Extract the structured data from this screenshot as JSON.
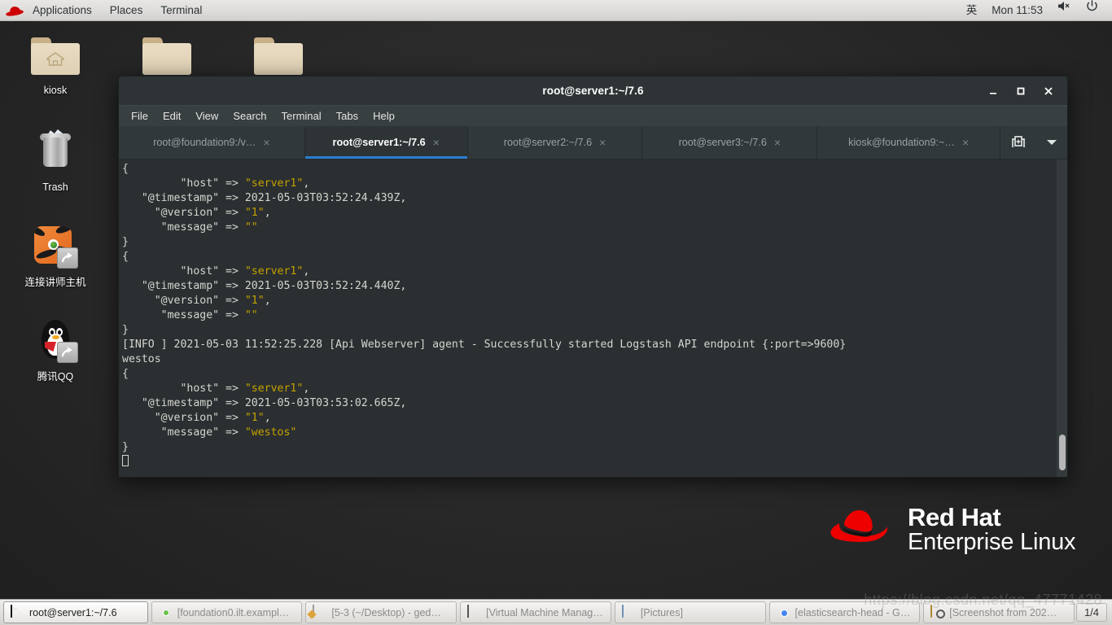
{
  "top_panel": {
    "logo_icon": "redhat-hat-icon",
    "menus": [
      "Applications",
      "Places",
      "Terminal"
    ],
    "input_method": "英",
    "clock": "Mon 11:53",
    "volume_icon": "volume-muted-icon",
    "power_icon": "power-icon"
  },
  "desktop": {
    "icons": [
      {
        "label": "kiosk",
        "icon": "home-folder-icon"
      },
      {
        "label": "Trash",
        "icon": "trash-icon"
      },
      {
        "label": "连接讲师主机",
        "icon": "tigervnc-shortcut-icon"
      },
      {
        "label": "腾讯QQ",
        "icon": "qq-shortcut-icon"
      }
    ],
    "folders": [
      {
        "icon": "folder-icon"
      },
      {
        "icon": "folder-icon"
      }
    ],
    "brand": {
      "line1": "Red Hat",
      "line2": "Enterprise Linux",
      "icon": "redhat-logo-icon"
    }
  },
  "terminal": {
    "title": "root@server1:~/7.6",
    "window_buttons": {
      "minimize": "−",
      "maximize": "□",
      "close": "✕"
    },
    "menus": [
      "File",
      "Edit",
      "View",
      "Search",
      "Terminal",
      "Tabs",
      "Help"
    ],
    "tabs": [
      {
        "label": "root@foundation9:/v…",
        "active": false
      },
      {
        "label": "root@server1:~/7.6",
        "active": true
      },
      {
        "label": "root@server2:~/7.6",
        "active": false
      },
      {
        "label": "root@server3:~/7.6",
        "active": false
      },
      {
        "label": "kiosk@foundation9:~…",
        "active": false
      }
    ],
    "new_tab_icon": "new-tab-icon",
    "tab_menu_icon": "chevron-down-icon",
    "close_tab_glyph": "×",
    "colors": {
      "background": "#2b2f31",
      "foreground": "#d3d7cf",
      "string": "#c4a000",
      "tab_active_underline": "#2a7fd4"
    },
    "output_lines": [
      {
        "text": "{"
      },
      {
        "text": "         \"host\" => ",
        "string": "\"server1\"",
        "tail": ","
      },
      {
        "text": "   \"@timestamp\" => 2021-05-03T03:52:24.439Z,"
      },
      {
        "text": "     \"@version\" => ",
        "string": "\"1\"",
        "tail": ","
      },
      {
        "text": "      \"message\" => ",
        "string": "\"\"",
        "tail": ""
      },
      {
        "text": "}"
      },
      {
        "text": "{"
      },
      {
        "text": "         \"host\" => ",
        "string": "\"server1\"",
        "tail": ","
      },
      {
        "text": "   \"@timestamp\" => 2021-05-03T03:52:24.440Z,"
      },
      {
        "text": "     \"@version\" => ",
        "string": "\"1\"",
        "tail": ","
      },
      {
        "text": "      \"message\" => ",
        "string": "\"\"",
        "tail": ""
      },
      {
        "text": "}"
      },
      {
        "text": "[INFO ] 2021-05-03 11:52:25.228 [Api Webserver] agent - Successfully started Logstash API endpoint {:port=>9600}"
      },
      {
        "text": "westos"
      },
      {
        "text": "{"
      },
      {
        "text": "         \"host\" => ",
        "string": "\"server1\"",
        "tail": ","
      },
      {
        "text": "   \"@timestamp\" => 2021-05-03T03:53:02.665Z,"
      },
      {
        "text": "     \"@version\" => ",
        "string": "\"1\"",
        "tail": ","
      },
      {
        "text": "      \"message\" => ",
        "string": "\"westos\"",
        "tail": ""
      },
      {
        "text": "}"
      }
    ]
  },
  "taskbar": {
    "items": [
      {
        "label": "root@server1:~/7.6",
        "icon": "terminal-icon",
        "active": true
      },
      {
        "label": "[foundation0.ilt.exampl…",
        "icon": "tigervnc-icon",
        "active": false
      },
      {
        "label": "[5-3 (~/Desktop) - ged…",
        "icon": "gedit-icon",
        "active": false
      },
      {
        "label": "[Virtual Machine Manag…",
        "icon": "virt-manager-icon",
        "active": false
      },
      {
        "label": "[Pictures]",
        "icon": "file-manager-icon",
        "active": false
      },
      {
        "label": "[elasticsearch-head - G…",
        "icon": "chrome-icon",
        "active": false
      },
      {
        "label": "[Screenshot from 202…",
        "icon": "screenshot-icon",
        "active": false
      }
    ],
    "pager": "1/4"
  },
  "watermark": "https://blog.csdn.net/qq_47771428"
}
